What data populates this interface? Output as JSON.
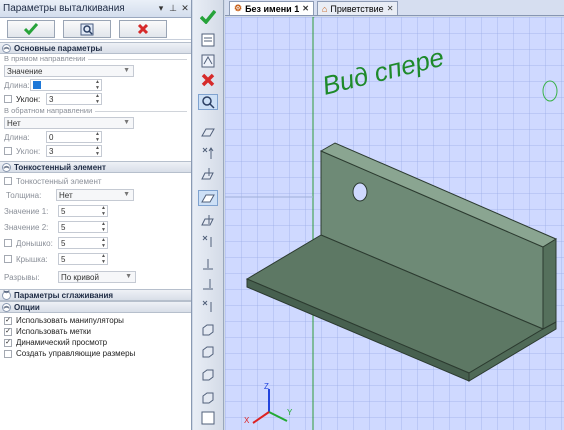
{
  "panel": {
    "title": "Параметры выталкивания",
    "pin_glyph": "▾ ᵩ ✕",
    "buttons": [
      "ok-icon",
      "preview-icon",
      "cancel-icon"
    ]
  },
  "main_params": {
    "header": "Основные параметры",
    "forward_group": "В прямом направлении",
    "forward_mode": "Значение",
    "length_label": "Длина:",
    "length_value": "",
    "slope_label": "Уклон:",
    "slope_value": "3",
    "reverse_group": "В обратном направлении",
    "reverse_mode": "Нет",
    "rev_length_label": "Длина:",
    "rev_length_value": "0",
    "rev_slope_label": "Уклон:",
    "rev_slope_value": "3"
  },
  "thin": {
    "header": "Тонкостенный элемент",
    "checkbox_label": "Тонкостенный элемент",
    "thickness_label": "Толщина:",
    "thickness_value": "Нет",
    "value1_label": "Значение 1:",
    "value1": "5",
    "value2_label": "Значение 2:",
    "value2": "5",
    "bottom_label": "Донышко:",
    "bottom_value": "5",
    "lid_label": "Крышка:",
    "lid_value": "5",
    "breaks_label": "Разрывы:",
    "breaks_value": "По кривой"
  },
  "smoothing": {
    "header": "Параметры сглаживания"
  },
  "options": {
    "header": "Опции",
    "items": [
      {
        "label": "Использовать манипуляторы",
        "checked": true
      },
      {
        "label": "Использовать метки",
        "checked": true
      },
      {
        "label": "Динамический просмотр",
        "checked": true
      },
      {
        "label": "Создать управляющие размеры",
        "checked": false
      }
    ]
  },
  "tabs": [
    {
      "label": "Без имени 1",
      "active": true
    },
    {
      "label": "Приветствие",
      "active": false
    }
  ],
  "viewport": {
    "view_label": "Вид спере",
    "axes": [
      "X",
      "Y",
      "Z"
    ]
  },
  "colors": {
    "accent_green": "#27a33a",
    "cancel_red": "#d62a2a",
    "part_green": "#62826c"
  }
}
